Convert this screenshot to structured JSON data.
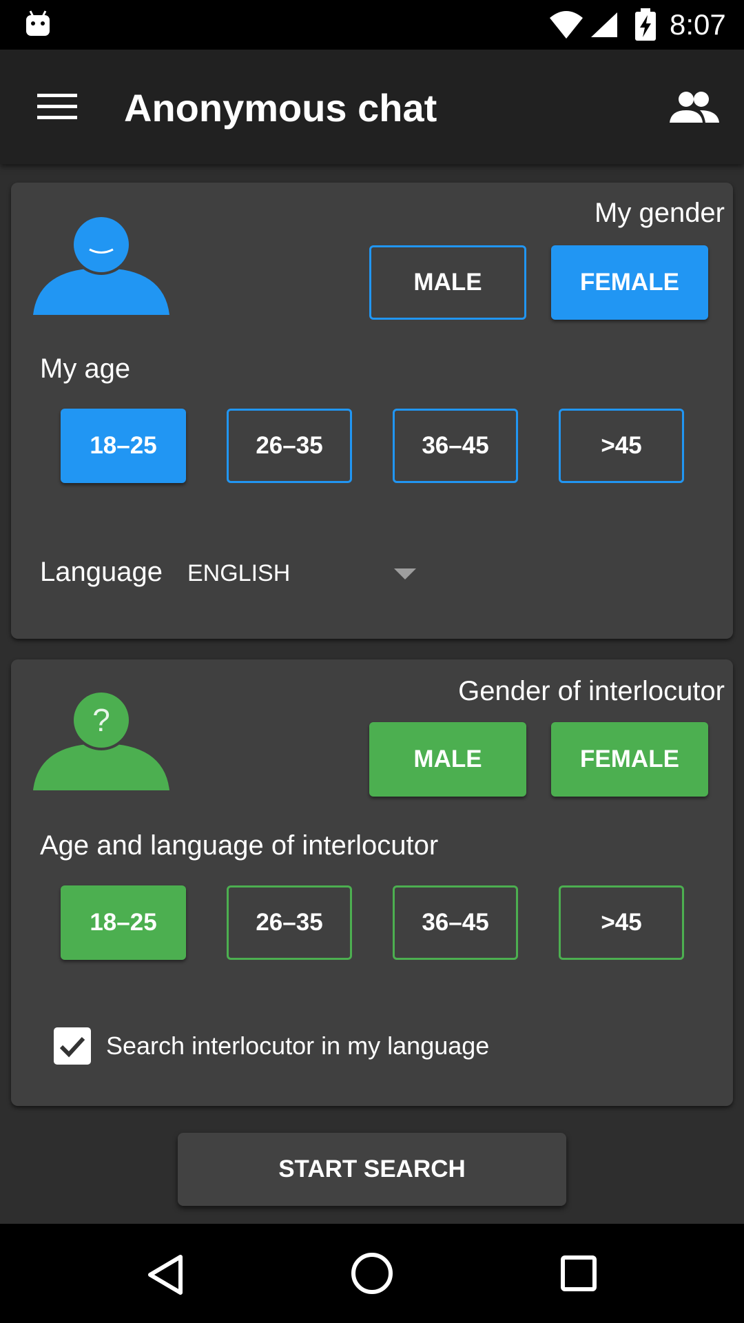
{
  "status_bar": {
    "time": "8:07"
  },
  "app_bar": {
    "title": "Anonymous chat"
  },
  "my_section": {
    "gender_label": "My gender",
    "gender_options": [
      "MALE",
      "FEMALE"
    ],
    "gender_selected": "FEMALE",
    "age_label": "My age",
    "age_options": [
      "18–25",
      "26–35",
      "36–45",
      ">45"
    ],
    "age_selected": "18–25",
    "language_label": "Language",
    "language_value": "ENGLISH",
    "accent_color": "#2196f3"
  },
  "interlocutor_section": {
    "avatar_symbol": "?",
    "gender_label": "Gender of interlocutor",
    "gender_options": [
      "MALE",
      "FEMALE"
    ],
    "gender_selected": [
      "MALE",
      "FEMALE"
    ],
    "age_label": "Age and language of interlocutor",
    "age_options": [
      "18–25",
      "26–35",
      "36–45",
      ">45"
    ],
    "age_selected": "18–25",
    "same_language_checkbox": {
      "label": "Search interlocutor in my language",
      "checked": true
    },
    "accent_color": "#4caf50"
  },
  "actions": {
    "start_search_label": "START SEARCH"
  },
  "icons": [
    "android-icon",
    "wifi-icon",
    "signal-icon",
    "battery-charging-icon",
    "menu-icon",
    "people-icon",
    "back-icon",
    "home-icon",
    "recents-icon"
  ]
}
